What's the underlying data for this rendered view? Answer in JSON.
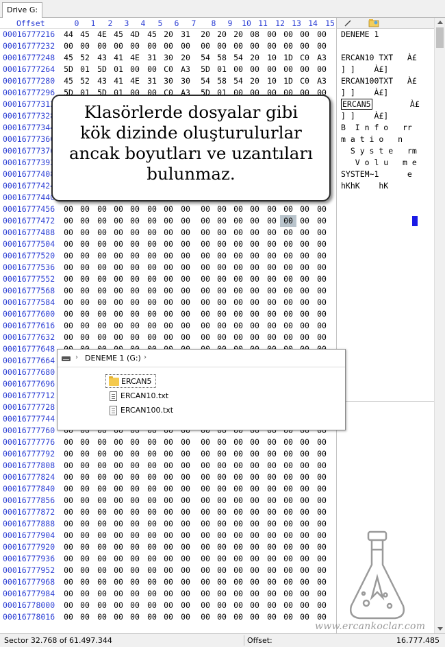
{
  "tab": {
    "label": "Drive G:"
  },
  "hex_header": {
    "offset_label": "Offset",
    "columns": [
      "0",
      "1",
      "2",
      "3",
      "4",
      "5",
      "6",
      "7",
      "8",
      "9",
      "10",
      "11",
      "12",
      "13",
      "14",
      "15"
    ]
  },
  "hex_rows": [
    {
      "offset": "00016777216",
      "bytes": [
        "44",
        "45",
        "4E",
        "45",
        "4D",
        "45",
        "20",
        "31",
        "20",
        "20",
        "20",
        "08",
        "00",
        "00",
        "00",
        "00"
      ]
    },
    {
      "offset": "00016777232",
      "bytes": [
        "00",
        "00",
        "00",
        "00",
        "00",
        "00",
        "00",
        "00",
        "00",
        "00",
        "00",
        "00",
        "00",
        "00",
        "00",
        "00"
      ]
    },
    {
      "offset": "00016777248",
      "bytes": [
        "45",
        "52",
        "43",
        "41",
        "4E",
        "31",
        "30",
        "20",
        "54",
        "58",
        "54",
        "20",
        "10",
        "1D",
        "C0",
        "A3"
      ]
    },
    {
      "offset": "00016777264",
      "bytes": [
        "5D",
        "01",
        "5D",
        "01",
        "00",
        "00",
        "C0",
        "A3",
        "5D",
        "01",
        "00",
        "00",
        "00",
        "00",
        "00",
        "00"
      ]
    },
    {
      "offset": "00016777280",
      "bytes": [
        "45",
        "52",
        "43",
        "41",
        "4E",
        "31",
        "30",
        "30",
        "54",
        "58",
        "54",
        "20",
        "10",
        "1D",
        "C0",
        "A3"
      ]
    },
    {
      "offset": "00016777296",
      "bytes": [
        "5D",
        "01",
        "5D",
        "01",
        "00",
        "00",
        "C0",
        "A3",
        "5D",
        "01",
        "00",
        "00",
        "00",
        "00",
        "00",
        "00"
      ]
    },
    {
      "offset": "00016777312",
      "bytes": [
        "",
        "",
        "",
        "",
        "",
        "",
        "",
        "",
        "",
        "",
        "",
        "",
        "",
        "",
        "",
        ""
      ]
    },
    {
      "offset": "00016777328",
      "bytes": [
        "",
        "",
        "",
        "",
        "",
        "",
        "",
        "",
        "",
        "",
        "",
        "",
        "",
        "",
        "",
        ""
      ]
    },
    {
      "offset": "00016777344",
      "bytes": [
        "",
        "",
        "",
        "",
        "",
        "",
        "",
        "",
        "",
        "",
        "",
        "",
        "",
        "",
        "",
        ""
      ]
    },
    {
      "offset": "00016777360",
      "bytes": [
        "",
        "",
        "",
        "",
        "",
        "",
        "",
        "",
        "",
        "",
        "",
        "",
        "",
        "",
        "",
        ""
      ]
    },
    {
      "offset": "00016777376",
      "bytes": [
        "",
        "",
        "",
        "",
        "",
        "",
        "",
        "",
        "",
        "",
        "",
        "",
        "",
        "",
        "",
        ""
      ]
    },
    {
      "offset": "00016777392",
      "bytes": [
        "",
        "",
        "",
        "",
        "",
        "",
        "",
        "",
        "",
        "",
        "",
        "",
        "",
        "",
        "",
        ""
      ]
    },
    {
      "offset": "00016777408",
      "bytes": [
        "",
        "",
        "",
        "",
        "",
        "",
        "",
        "",
        "",
        "",
        "",
        "",
        "",
        "",
        "",
        ""
      ]
    },
    {
      "offset": "00016777424",
      "bytes": [
        "",
        "",
        "",
        "",
        "",
        "",
        "",
        "",
        "",
        "",
        "",
        "",
        "",
        "",
        "",
        ""
      ]
    },
    {
      "offset": "00016777440",
      "bytes": [
        "",
        "",
        "",
        "",
        "",
        "",
        "",
        "",
        "",
        "",
        "",
        "",
        "",
        "",
        "",
        ""
      ]
    },
    {
      "offset": "00016777456",
      "bytes": [
        "00",
        "00",
        "00",
        "00",
        "00",
        "00",
        "00",
        "00",
        "00",
        "00",
        "00",
        "00",
        "00",
        "00",
        "00",
        "00"
      ]
    },
    {
      "offset": "00016777472",
      "bytes": [
        "00",
        "00",
        "00",
        "00",
        "00",
        "00",
        "00",
        "00",
        "00",
        "00",
        "00",
        "00",
        "00",
        "00",
        "00",
        "00"
      ]
    },
    {
      "offset": "00016777488",
      "bytes": [
        "00",
        "00",
        "00",
        "00",
        "00",
        "00",
        "00",
        "00",
        "00",
        "00",
        "00",
        "00",
        "00",
        "00",
        "00",
        "00"
      ]
    },
    {
      "offset": "00016777504",
      "bytes": [
        "00",
        "00",
        "00",
        "00",
        "00",
        "00",
        "00",
        "00",
        "00",
        "00",
        "00",
        "00",
        "00",
        "00",
        "00",
        "00"
      ]
    },
    {
      "offset": "00016777520",
      "bytes": [
        "00",
        "00",
        "00",
        "00",
        "00",
        "00",
        "00",
        "00",
        "00",
        "00",
        "00",
        "00",
        "00",
        "00",
        "00",
        "00"
      ]
    },
    {
      "offset": "00016777536",
      "bytes": [
        "00",
        "00",
        "00",
        "00",
        "00",
        "00",
        "00",
        "00",
        "00",
        "00",
        "00",
        "00",
        "00",
        "00",
        "00",
        "00"
      ]
    },
    {
      "offset": "00016777552",
      "bytes": [
        "00",
        "00",
        "00",
        "00",
        "00",
        "00",
        "00",
        "00",
        "00",
        "00",
        "00",
        "00",
        "00",
        "00",
        "00",
        "00"
      ]
    },
    {
      "offset": "00016777568",
      "bytes": [
        "00",
        "00",
        "00",
        "00",
        "00",
        "00",
        "00",
        "00",
        "00",
        "00",
        "00",
        "00",
        "00",
        "00",
        "00",
        "00"
      ]
    },
    {
      "offset": "00016777584",
      "bytes": [
        "00",
        "00",
        "00",
        "00",
        "00",
        "00",
        "00",
        "00",
        "00",
        "00",
        "00",
        "00",
        "00",
        "00",
        "00",
        "00"
      ]
    },
    {
      "offset": "00016777600",
      "bytes": [
        "00",
        "00",
        "00",
        "00",
        "00",
        "00",
        "00",
        "00",
        "00",
        "00",
        "00",
        "00",
        "00",
        "00",
        "00",
        "00"
      ]
    },
    {
      "offset": "00016777616",
      "bytes": [
        "00",
        "00",
        "00",
        "00",
        "00",
        "00",
        "00",
        "00",
        "00",
        "00",
        "00",
        "00",
        "00",
        "00",
        "00",
        "00"
      ]
    },
    {
      "offset": "00016777632",
      "bytes": [
        "00",
        "00",
        "00",
        "00",
        "00",
        "00",
        "00",
        "00",
        "00",
        "00",
        "00",
        "00",
        "00",
        "00",
        "00",
        "00"
      ]
    },
    {
      "offset": "00016777648",
      "bytes": [
        "00",
        "00",
        "00",
        "00",
        "00",
        "00",
        "00",
        "00",
        "00",
        "00",
        "00",
        "00",
        "00",
        "00",
        "00",
        "00"
      ]
    },
    {
      "offset": "00016777664",
      "bytes": [
        "00",
        "00",
        "00",
        "00",
        "00",
        "00",
        "00",
        "00",
        "00",
        "00",
        "00",
        "00",
        "00",
        "00",
        "00",
        "00"
      ]
    },
    {
      "offset": "00016777680",
      "bytes": [
        "00",
        "00",
        "00",
        "00",
        "00",
        "00",
        "00",
        "00",
        "00",
        "00",
        "00",
        "00",
        "00",
        "00",
        "00",
        "00"
      ]
    },
    {
      "offset": "00016777696",
      "bytes": [
        "00",
        "00",
        "00",
        "00",
        "00",
        "00",
        "00",
        "00",
        "00",
        "00",
        "00",
        "00",
        "00",
        "00",
        "00",
        "00"
      ]
    },
    {
      "offset": "00016777712",
      "bytes": [
        "00",
        "00",
        "00",
        "00",
        "00",
        "00",
        "00",
        "00",
        "00",
        "00",
        "00",
        "00",
        "00",
        "00",
        "00",
        "00"
      ]
    },
    {
      "offset": "00016777728",
      "bytes": [
        "00",
        "00",
        "00",
        "00",
        "00",
        "00",
        "00",
        "00",
        "00",
        "00",
        "00",
        "00",
        "00",
        "00",
        "00",
        "00"
      ]
    },
    {
      "offset": "00016777744",
      "bytes": [
        "00",
        "00",
        "00",
        "00",
        "00",
        "00",
        "00",
        "00",
        "00",
        "00",
        "00",
        "00",
        "00",
        "00",
        "00",
        "00"
      ]
    },
    {
      "offset": "00016777760",
      "bytes": [
        "00",
        "00",
        "00",
        "00",
        "00",
        "00",
        "00",
        "00",
        "00",
        "00",
        "00",
        "00",
        "00",
        "00",
        "00",
        "00"
      ]
    },
    {
      "offset": "00016777776",
      "bytes": [
        "00",
        "00",
        "00",
        "00",
        "00",
        "00",
        "00",
        "00",
        "00",
        "00",
        "00",
        "00",
        "00",
        "00",
        "00",
        "00"
      ]
    },
    {
      "offset": "00016777792",
      "bytes": [
        "00",
        "00",
        "00",
        "00",
        "00",
        "00",
        "00",
        "00",
        "00",
        "00",
        "00",
        "00",
        "00",
        "00",
        "00",
        "00"
      ]
    },
    {
      "offset": "00016777808",
      "bytes": [
        "00",
        "00",
        "00",
        "00",
        "00",
        "00",
        "00",
        "00",
        "00",
        "00",
        "00",
        "00",
        "00",
        "00",
        "00",
        "00"
      ]
    },
    {
      "offset": "00016777824",
      "bytes": [
        "00",
        "00",
        "00",
        "00",
        "00",
        "00",
        "00",
        "00",
        "00",
        "00",
        "00",
        "00",
        "00",
        "00",
        "00",
        "00"
      ]
    },
    {
      "offset": "00016777840",
      "bytes": [
        "00",
        "00",
        "00",
        "00",
        "00",
        "00",
        "00",
        "00",
        "00",
        "00",
        "00",
        "00",
        "00",
        "00",
        "00",
        "00"
      ]
    },
    {
      "offset": "00016777856",
      "bytes": [
        "00",
        "00",
        "00",
        "00",
        "00",
        "00",
        "00",
        "00",
        "00",
        "00",
        "00",
        "00",
        "00",
        "00",
        "00",
        "00"
      ]
    },
    {
      "offset": "00016777872",
      "bytes": [
        "00",
        "00",
        "00",
        "00",
        "00",
        "00",
        "00",
        "00",
        "00",
        "00",
        "00",
        "00",
        "00",
        "00",
        "00",
        "00"
      ]
    },
    {
      "offset": "00016777888",
      "bytes": [
        "00",
        "00",
        "00",
        "00",
        "00",
        "00",
        "00",
        "00",
        "00",
        "00",
        "00",
        "00",
        "00",
        "00",
        "00",
        "00"
      ]
    },
    {
      "offset": "00016777904",
      "bytes": [
        "00",
        "00",
        "00",
        "00",
        "00",
        "00",
        "00",
        "00",
        "00",
        "00",
        "00",
        "00",
        "00",
        "00",
        "00",
        "00"
      ]
    },
    {
      "offset": "00016777920",
      "bytes": [
        "00",
        "00",
        "00",
        "00",
        "00",
        "00",
        "00",
        "00",
        "00",
        "00",
        "00",
        "00",
        "00",
        "00",
        "00",
        "00"
      ]
    },
    {
      "offset": "00016777936",
      "bytes": [
        "00",
        "00",
        "00",
        "00",
        "00",
        "00",
        "00",
        "00",
        "00",
        "00",
        "00",
        "00",
        "00",
        "00",
        "00",
        "00"
      ]
    },
    {
      "offset": "00016777952",
      "bytes": [
        "00",
        "00",
        "00",
        "00",
        "00",
        "00",
        "00",
        "00",
        "00",
        "00",
        "00",
        "00",
        "00",
        "00",
        "00",
        "00"
      ]
    },
    {
      "offset": "00016777968",
      "bytes": [
        "00",
        "00",
        "00",
        "00",
        "00",
        "00",
        "00",
        "00",
        "00",
        "00",
        "00",
        "00",
        "00",
        "00",
        "00",
        "00"
      ]
    },
    {
      "offset": "00016777984",
      "bytes": [
        "00",
        "00",
        "00",
        "00",
        "00",
        "00",
        "00",
        "00",
        "00",
        "00",
        "00",
        "00",
        "00",
        "00",
        "00",
        "00"
      ]
    },
    {
      "offset": "00016778000",
      "bytes": [
        "00",
        "00",
        "00",
        "00",
        "00",
        "00",
        "00",
        "00",
        "00",
        "00",
        "00",
        "00",
        "00",
        "00",
        "00",
        "00"
      ]
    },
    {
      "offset": "00016778016",
      "bytes": [
        "00",
        "00",
        "00",
        "00",
        "00",
        "00",
        "00",
        "00",
        "00",
        "00",
        "00",
        "00",
        "00",
        "00",
        "00",
        "00"
      ]
    }
  ],
  "selected_cell": {
    "row": 16,
    "col": 13
  },
  "text_lines": [
    "DENEME 1",
    "",
    "ERCAN10 TXT   À£",
    "] ]    À£]",
    "ERCAN100TXT   À£",
    "] ]    À£]",
    "ERCAN5        À£",
    "] ]    À£]",
    "B  I n f o   rr",
    "m a t i o   n",
    "  S y s t e   rm",
    "   V o l u   m e",
    "SYSTEM~1      e",
    "hKhK    hK"
  ],
  "boxed_text_line": 6,
  "callout": {
    "lines": [
      "Klasörlerde dosyalar gibi",
      "kök dizinde oluşturulurlar",
      "ancak boyutları ve uzantıları",
      "bulunmaz."
    ]
  },
  "explorer": {
    "breadcrumb": "DENEME 1 (G:)",
    "items": [
      {
        "name": "ERCAN5",
        "type": "folder",
        "icon": "folder-icon"
      },
      {
        "name": "ERCAN10.txt",
        "type": "file",
        "icon": "text-file-icon"
      },
      {
        "name": "ERCAN100.txt",
        "type": "file",
        "icon": "text-file-icon"
      }
    ]
  },
  "status": {
    "sector": "Sector 32.768 of 61.497.344",
    "offset_label": "Offset:",
    "offset_value": "16.777.485"
  },
  "watermark": {
    "text": "www.ercankoclar.com",
    "icon": "flask-logo-icon"
  },
  "colors": {
    "offset_blue": "#2c3fd4",
    "caret_blue": "#1a1ae6",
    "selection_gray": "#b9c4cc"
  }
}
